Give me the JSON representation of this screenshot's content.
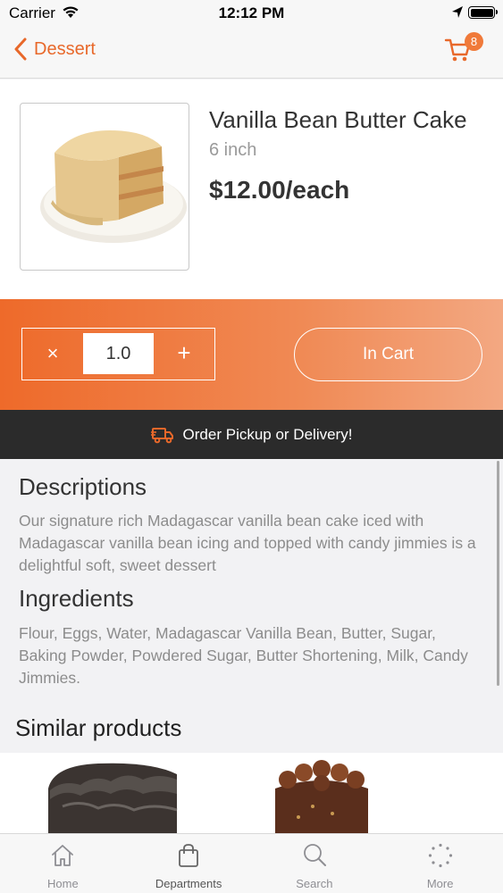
{
  "status_bar": {
    "carrier": "Carrier",
    "time": "12:12 PM"
  },
  "nav": {
    "back_label": "Dessert",
    "cart_count": "8"
  },
  "product": {
    "name": "Vanilla Bean Butter Cake",
    "size": "6 inch",
    "price": "$12.00/each"
  },
  "quantity": {
    "minus": "×",
    "value": "1.0",
    "plus": "+",
    "cart_button": "In Cart"
  },
  "delivery": {
    "label": "Order Pickup or Delivery!"
  },
  "descriptions": {
    "title": "Descriptions",
    "body": "Our signature rich Madagascar vanilla bean cake iced with Madagascar vanilla bean icing and topped with candy jimmies is a delightful soft, sweet dessert"
  },
  "ingredients": {
    "title": "Ingredients",
    "body": "Flour, Eggs, Water, Madagascar Vanilla Bean, Butter, Sugar, Baking Powder, Powdered Sugar, Butter Shortening, Milk, Candy Jimmies."
  },
  "similar": {
    "title": "Similar products"
  },
  "tabs": [
    {
      "label": "Home",
      "icon": "home-icon"
    },
    {
      "label": "Departments",
      "icon": "bag-icon"
    },
    {
      "label": "Search",
      "icon": "search-icon"
    },
    {
      "label": "More",
      "icon": "more-icon"
    }
  ],
  "colors": {
    "accent": "#e8682a",
    "band_start": "#ee6a2a",
    "band_end": "#f3a882",
    "strip": "#2b2b2b"
  }
}
